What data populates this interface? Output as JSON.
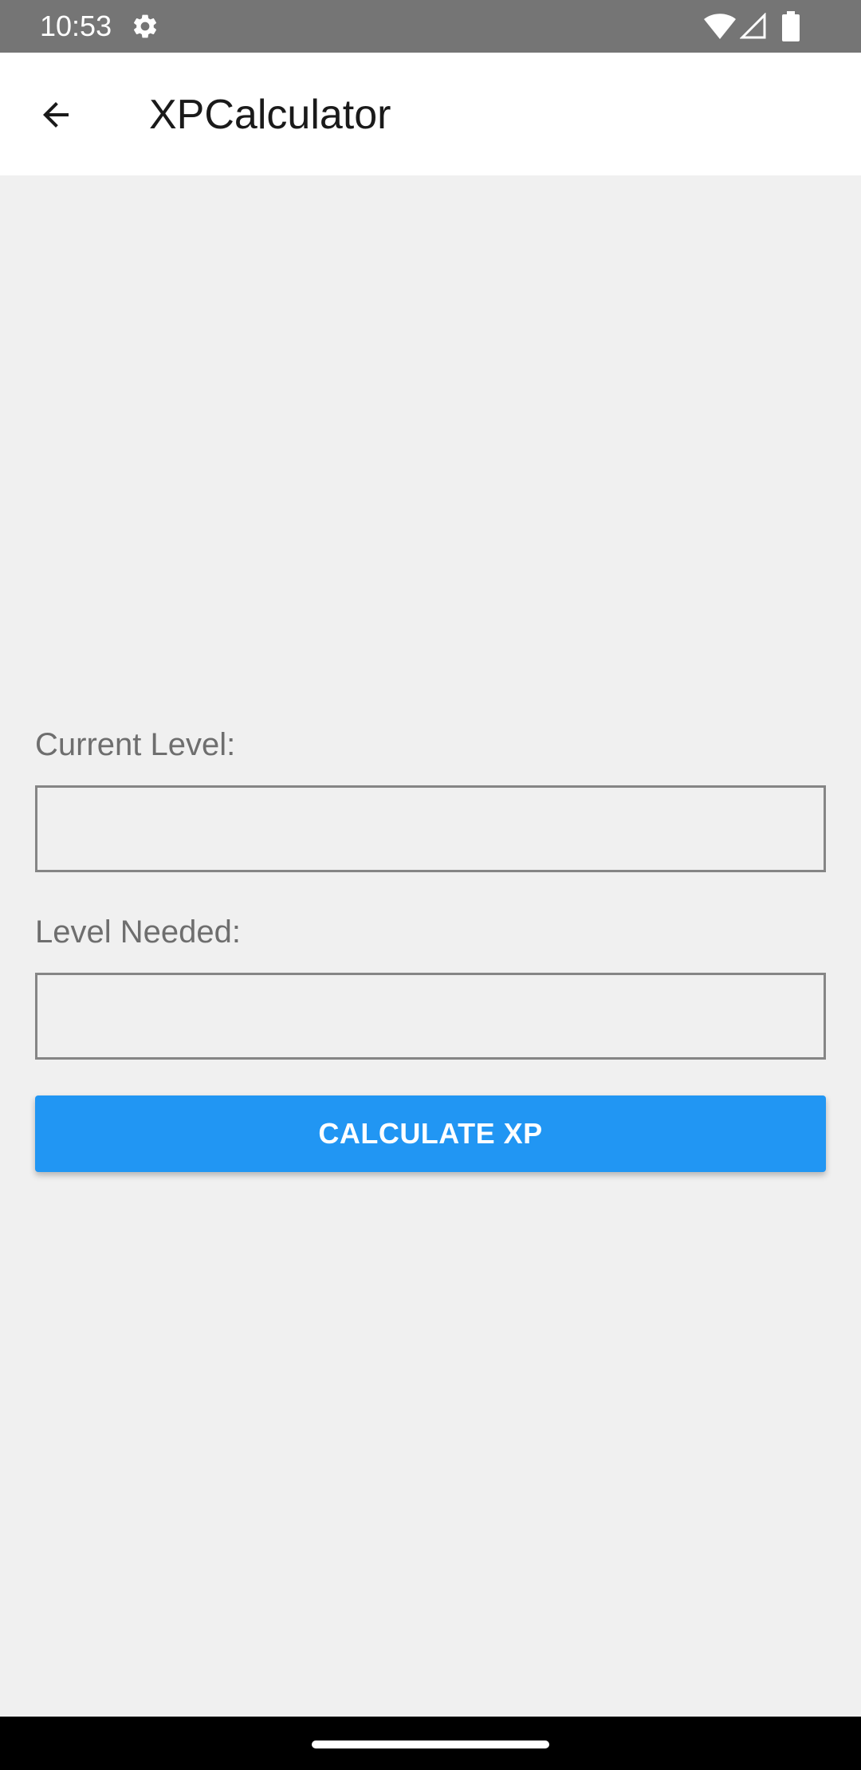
{
  "status_bar": {
    "time": "10:53",
    "icons": [
      "settings-icon",
      "wifi-icon",
      "signal-icon",
      "battery-icon"
    ]
  },
  "app_bar": {
    "title": "XPCalculator",
    "back_icon": "arrow-back-icon"
  },
  "form": {
    "current_level": {
      "label": "Current Level:",
      "value": "",
      "placeholder": ""
    },
    "level_needed": {
      "label": "Level Needed:",
      "value": "",
      "placeholder": ""
    },
    "calculate_label": "CALCULATE XP"
  },
  "colors": {
    "status_bar": "#757575",
    "app_bar": "#ffffff",
    "background": "#f0f0f0",
    "accent_button": "#2196f3",
    "nav_bar": "#000000"
  }
}
